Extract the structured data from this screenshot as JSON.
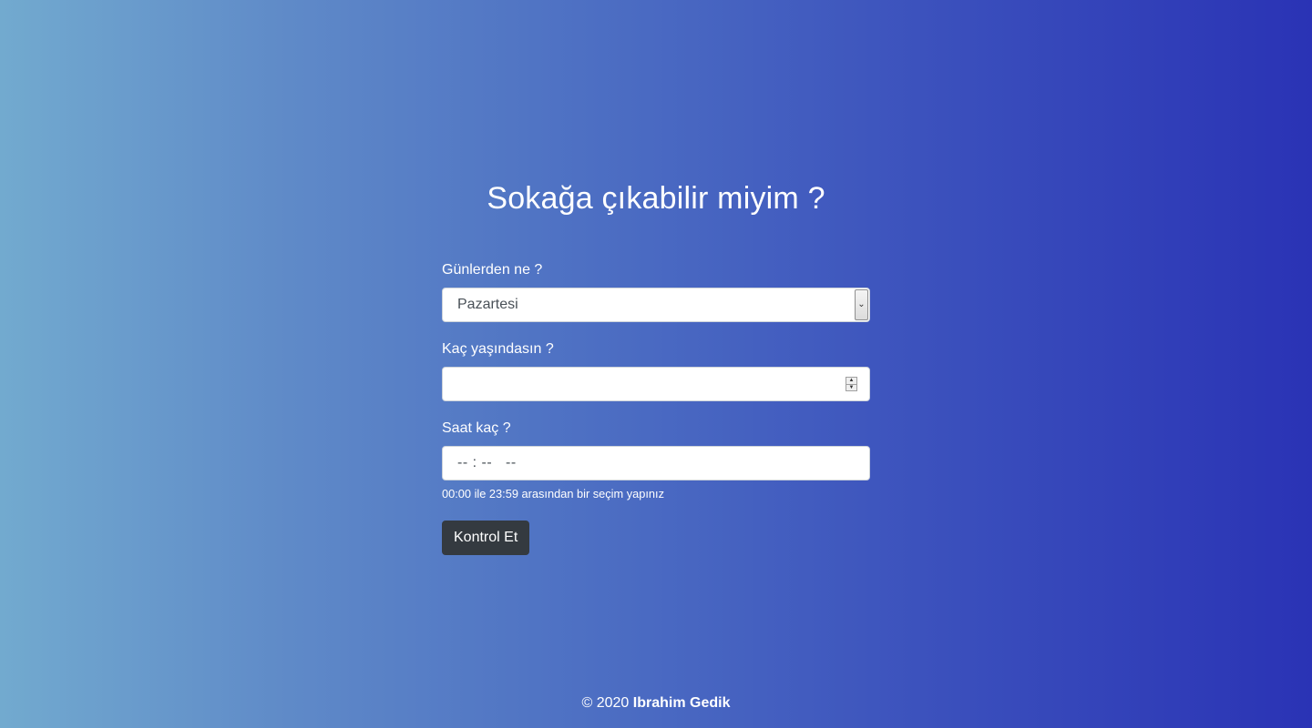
{
  "page": {
    "title": "Sokağa çıkabilir miyim ?"
  },
  "form": {
    "day_label": "Günlerden ne ?",
    "day_selected": "Pazartesi",
    "age_label": "Kaç yaşındasın ?",
    "age_value": "",
    "time_label": "Saat kaç ?",
    "time_placeholder": "-- : --   --",
    "time_help": "00:00 ile 23:59 arasından bir seçim yapınız",
    "submit_label": "Kontrol Et"
  },
  "footer": {
    "copyright": "© 2020",
    "author": "Ibrahim Gedik"
  },
  "colors": {
    "gradient_left": "#72aacf",
    "gradient_right": "#2a33b5",
    "button_bg": "#343a40"
  },
  "icons": {
    "select_arrow": "chevron-down-icon",
    "spinner": "spinner-arrows-icon"
  }
}
